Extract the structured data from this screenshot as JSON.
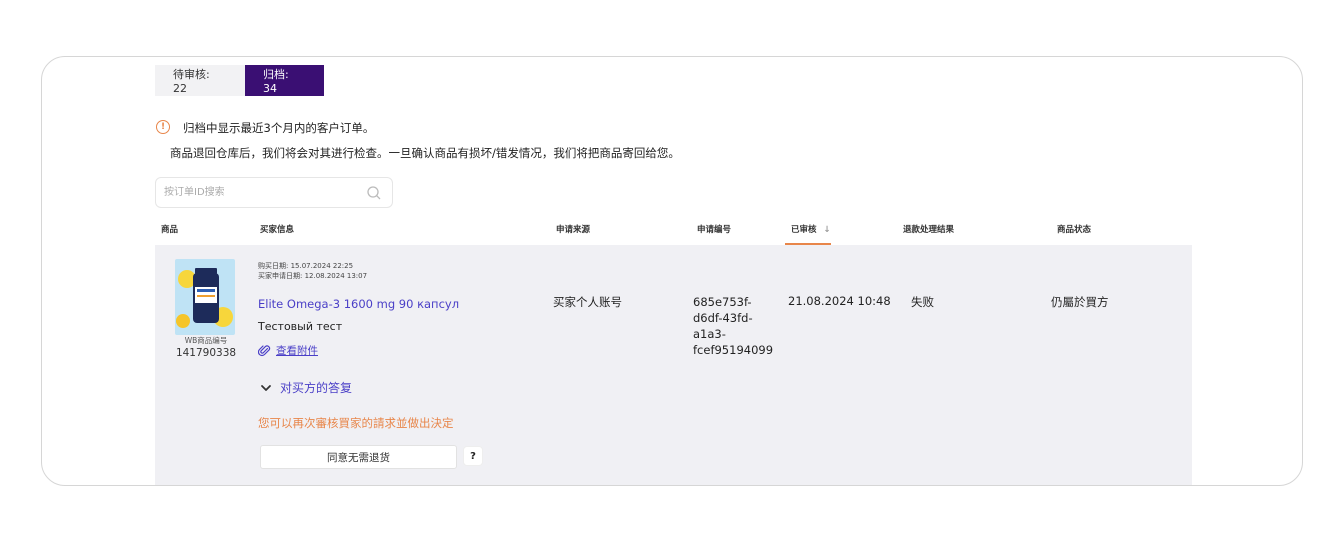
{
  "tabs": {
    "pending_label": "待审核: 22",
    "archived_label": "归档: 34"
  },
  "notice": {
    "icon": "info-icon",
    "line1": "归档中显示最近3个月内的客户订单。",
    "line2": "商品退回仓库后，我们将会对其进行检查。一旦确认商品有损坏/错发情况，我们将把商品寄回给您。"
  },
  "search": {
    "placeholder": "按订单ID搜索",
    "value": ""
  },
  "table": {
    "headers": {
      "product": "商品",
      "buyer_info": "买家信息",
      "source": "申请来源",
      "app_number": "申请编号",
      "reviewed": "已审核",
      "refund_result": "退款处理结果",
      "product_status": "商品状态"
    },
    "sort_indicator": "↓",
    "rows": [
      {
        "wb_label": "WB商品编号",
        "wb_id": "141790338",
        "buy_date": "购买日期: 15.07.2024 22:25",
        "apply_date": "买家申请日期: 12.08.2024 13:07",
        "product_name": "Elite Omega-3 1600 mg 90 капсул",
        "comment": "Тестовый тест",
        "attachment_label": "查看附件",
        "reply_toggle": "对买方的答复",
        "review_note": "您可以再次審核買家的請求並做出決定",
        "agree_button": "同意无需退货",
        "help_button": "?",
        "source": "买家个人账号",
        "app_number_lines": [
          "685e753f-",
          "d6df-43fd-",
          "a1a3-",
          "fcef95194099"
        ],
        "reviewed": "21.08.2024 10:48",
        "refund_result": "失败",
        "product_status": "仍屬於買方"
      }
    ]
  },
  "colors": {
    "active_tab": "#3a0f73",
    "accent_orange": "#e8864a",
    "link_purple": "#4a3fc7",
    "row_bg": "#f0f0f4"
  }
}
